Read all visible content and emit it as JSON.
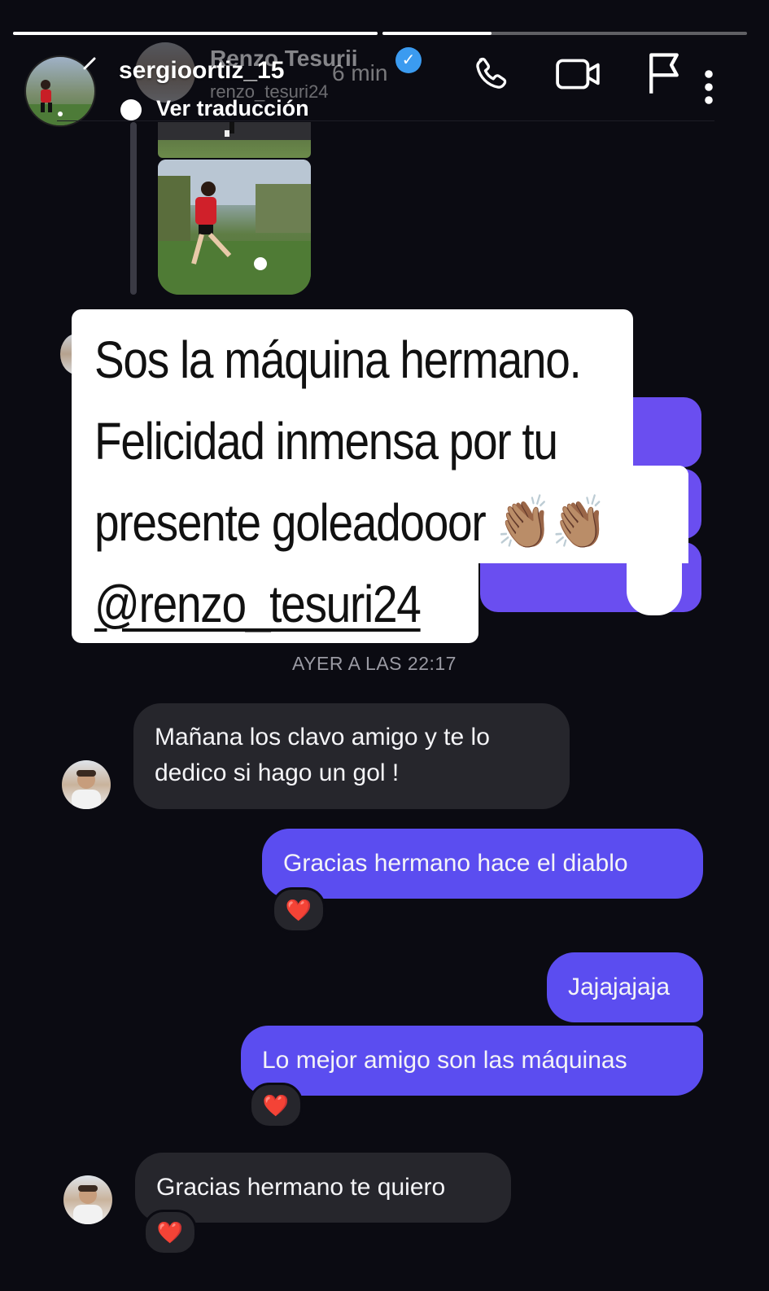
{
  "story": {
    "username": "sergioortiz_15",
    "translate_label": "Ver traducción",
    "progress": [
      1.0,
      0.3
    ]
  },
  "chat_header": {
    "name": "Renzo Tesurii",
    "time": "6 min",
    "handle": "renzo_tesuri24",
    "icons": [
      "phone-icon",
      "video-icon",
      "flag-icon",
      "more-icon"
    ]
  },
  "story_card": {
    "lines": [
      "Sos la máquina hermano.",
      "Felicidad inmensa por tu",
      "presente goleadooor 👏🏽👏🏽"
    ],
    "mention": "@renzo_tesuri24"
  },
  "timestamp": "AYER A LAS 22:17",
  "messages": [
    {
      "side": "in",
      "text_lines": [
        "Mañana los clavo amigo y te lo",
        "dedico si hago un gol !"
      ]
    },
    {
      "side": "out",
      "text": "Gracias hermano hace el diablo",
      "reaction": "❤️"
    },
    {
      "side": "out",
      "text": "Jajajajaja"
    },
    {
      "side": "out",
      "text": "Lo mejor amigo son las máquinas",
      "reaction": "❤️"
    },
    {
      "side": "in",
      "text": "Gracias hermano te quiero",
      "reaction": "❤️"
    }
  ],
  "colors": {
    "background": "#0b0b12",
    "incoming_bubble": "#26262c",
    "outgoing_bubble": "#5b4df0",
    "verified": "#3b9bf0"
  }
}
